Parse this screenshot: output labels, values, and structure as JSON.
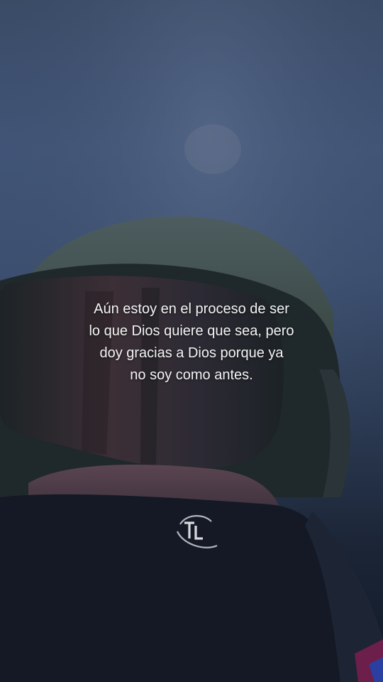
{
  "quote": {
    "lines": [
      "Aún estoy en el proceso de ser",
      "lo que Dios quiere que sea, pero",
      "doy gracias a Dios porque ya",
      "no soy como antes."
    ]
  },
  "logo": {
    "text": "TL"
  },
  "colors": {
    "sky": "#3f5273",
    "beanie": "#4a5a5a",
    "goggle_frame": "#1c2528",
    "mask": "#151a27",
    "text": "#f4f4f4"
  }
}
